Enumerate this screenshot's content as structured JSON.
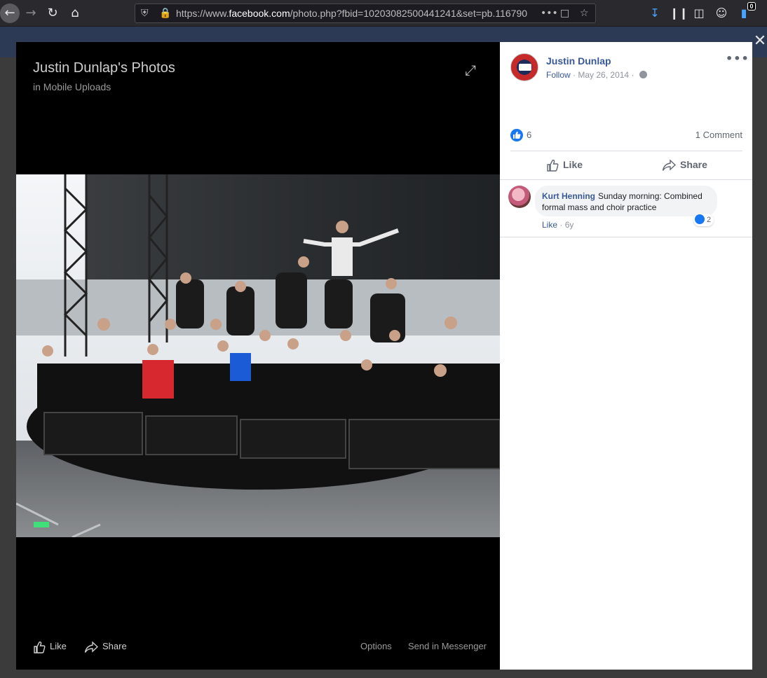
{
  "browser": {
    "url_prefix": "https://www.",
    "url_domain": "facebook.com",
    "url_path": "/photo.php?fbid=10203082500441241&set=pb.116790",
    "downloads_badge": "0"
  },
  "viewer": {
    "title": "Justin Dunlap's Photos",
    "subtitle": "in Mobile Uploads",
    "actions": {
      "like": "Like",
      "share": "Share",
      "options": "Options",
      "send": "Send in Messenger"
    }
  },
  "post": {
    "author": "Justin Dunlap",
    "follow": "Follow",
    "date": "May 26, 2014",
    "separator": "·",
    "reactions_count": "6",
    "comments_count": "1 Comment",
    "like_label": "Like",
    "share_label": "Share"
  },
  "comment": {
    "author": "Kurt Henning",
    "text": "Sunday morning: Combined formal mass and choir practice",
    "reactions": "2",
    "like": "Like",
    "separator": "·",
    "age": "6y"
  }
}
